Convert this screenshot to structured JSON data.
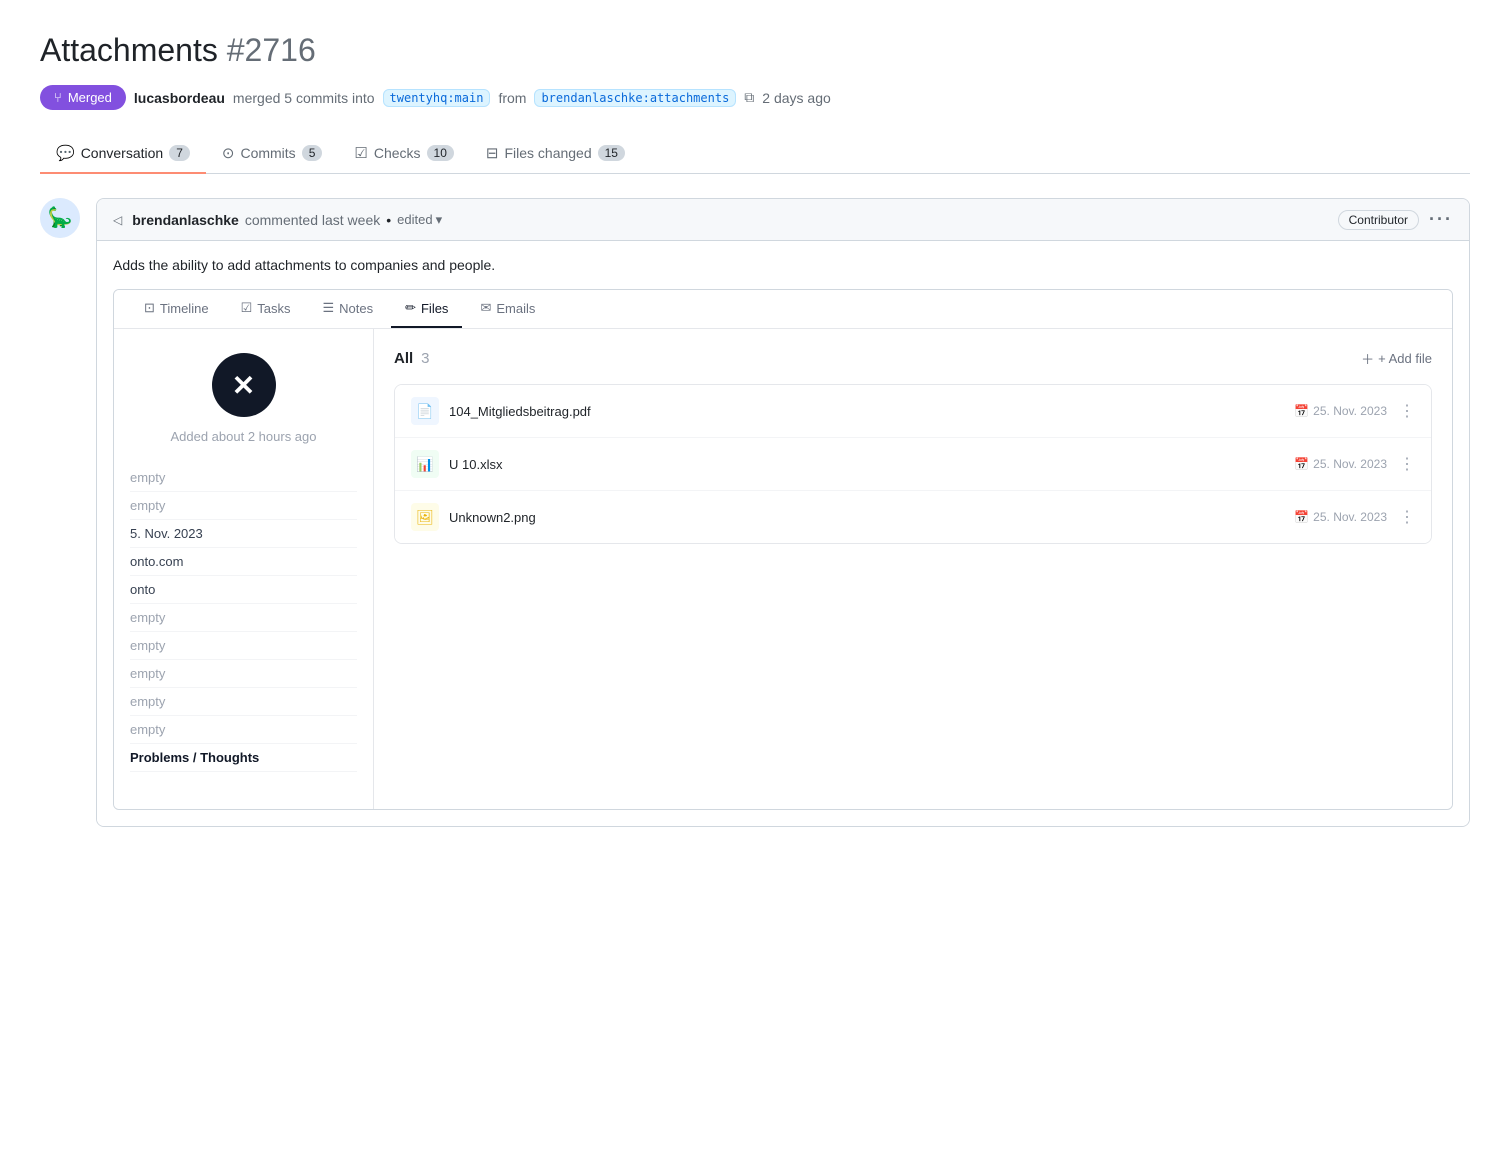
{
  "page": {
    "title": "Attachments",
    "pr_number": "#2716"
  },
  "pr_meta": {
    "badge": "Merged",
    "merge_icon": "⑂",
    "author": "lucasbordeau",
    "action": "merged 5 commits into",
    "target_branch": "twentyhq:main",
    "from": "from",
    "source_branch": "brendanlaschke:attachments",
    "copy_icon": "⧉",
    "time_ago": "2 days ago"
  },
  "tabs": [
    {
      "id": "conversation",
      "label": "Conversation",
      "badge": "7",
      "icon": "💬",
      "active": true
    },
    {
      "id": "commits",
      "label": "Commits",
      "badge": "5",
      "icon": "○",
      "active": false
    },
    {
      "id": "checks",
      "label": "Checks",
      "badge": "10",
      "icon": "☑",
      "active": false
    },
    {
      "id": "files-changed",
      "label": "Files changed",
      "badge": "15",
      "icon": "⊟",
      "active": false
    }
  ],
  "comment": {
    "author": "brendanlaschke",
    "action": "commented last week",
    "separator": "•",
    "edited_label": "edited",
    "contributor_label": "Contributor",
    "more_icon": "···",
    "description": "Adds the ability to add attachments to companies and people.",
    "collapse_icon": "◁"
  },
  "app_nav": {
    "items": [
      {
        "id": "timeline",
        "label": "Timeline",
        "icon": "⊡",
        "active": false
      },
      {
        "id": "tasks",
        "label": "Tasks",
        "icon": "☑",
        "active": false
      },
      {
        "id": "notes",
        "label": "Notes",
        "icon": "☰",
        "active": false
      },
      {
        "id": "files",
        "label": "Files",
        "icon": "✏",
        "active": true
      },
      {
        "id": "emails",
        "label": "Emails",
        "icon": "✉",
        "active": false
      }
    ]
  },
  "left_panel": {
    "logo_icon": "✕",
    "added_text": "Added about 2 hours ago",
    "list_items": [
      {
        "value": "empty",
        "label": "",
        "is_value": false
      },
      {
        "value": "empty",
        "label": "",
        "is_value": false
      },
      {
        "value": "5. Nov. 2023",
        "label": "5. Nov. 2023",
        "is_value": true
      },
      {
        "value": "onto.com",
        "label": "onto.com",
        "is_value": true
      },
      {
        "value": "onto",
        "label": "onto",
        "is_value": true
      },
      {
        "value": "empty",
        "label": "",
        "is_value": false
      },
      {
        "value": "empty",
        "label": "",
        "is_value": false
      },
      {
        "value": "empty",
        "label": "",
        "is_value": false
      },
      {
        "value": "empty",
        "label": "",
        "is_value": false
      },
      {
        "value": "empty",
        "label": "",
        "is_value": false
      },
      {
        "value": "Problems / Thoughts",
        "label": "Problems / Thoughts",
        "is_value": true,
        "bold": true
      }
    ]
  },
  "files_panel": {
    "all_label": "All",
    "count": "3",
    "add_file_label": "+ Add file",
    "files": [
      {
        "name": "104_Mitgliedsbeitrag.pdf",
        "type": "pdf",
        "icon": "📄",
        "date": "25. Nov. 2023",
        "calendar_icon": "📅"
      },
      {
        "name": "U 10.xlsx",
        "type": "xlsx",
        "icon": "📊",
        "date": "25. Nov. 2023",
        "calendar_icon": "📅"
      },
      {
        "name": "Unknown2.png",
        "type": "png",
        "icon": "🖼",
        "date": "25. Nov. 2023",
        "calendar_icon": "📅"
      }
    ]
  }
}
